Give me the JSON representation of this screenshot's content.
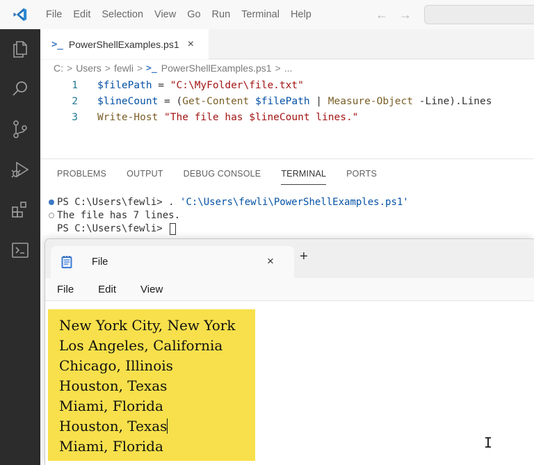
{
  "menubar": {
    "items": [
      "File",
      "Edit",
      "Selection",
      "View",
      "Go",
      "Run",
      "Terminal",
      "Help"
    ],
    "back_arrow": "←",
    "forward_arrow": "→"
  },
  "activity_icons": [
    "explorer-icon",
    "search-icon",
    "source-control-icon",
    "run-debug-icon",
    "extensions-icon",
    "terminal-icon"
  ],
  "editor": {
    "tab": {
      "icon": ">_",
      "label": "PowerShellExamples.ps1",
      "close": "×"
    },
    "breadcrumb": {
      "parts": [
        "C:",
        "Users",
        "fewli",
        "PowerShellExamples.ps1",
        "..."
      ],
      "separator": ">"
    },
    "lines": [
      {
        "num": "1",
        "tokens": [
          {
            "t": "$filePath",
            "k": "var"
          },
          {
            "t": " = ",
            "k": "op"
          },
          {
            "t": "\"C:\\MyFolder\\file.txt\"",
            "k": "str"
          }
        ]
      },
      {
        "num": "2",
        "tokens": [
          {
            "t": "$lineCount",
            "k": "var"
          },
          {
            "t": " = (",
            "k": "op"
          },
          {
            "t": "Get-Content",
            "k": "cmd"
          },
          {
            "t": " ",
            "k": "op"
          },
          {
            "t": "$filePath",
            "k": "var"
          },
          {
            "t": " | ",
            "k": "op"
          },
          {
            "t": "Measure-Object",
            "k": "cmd"
          },
          {
            "t": " -Line).Lines",
            "k": "param"
          }
        ]
      },
      {
        "num": "3",
        "tokens": [
          {
            "t": "Write-Host",
            "k": "cmd"
          },
          {
            "t": " ",
            "k": "op"
          },
          {
            "t": "\"The file has $lineCount lines.\"",
            "k": "str"
          }
        ]
      }
    ]
  },
  "panel": {
    "tabs": [
      "PROBLEMS",
      "OUTPUT",
      "DEBUG CONSOLE",
      "TERMINAL",
      "PORTS"
    ],
    "active_tab": "TERMINAL",
    "terminal": {
      "line1_prompt": "PS C:\\Users\\fewli> . ",
      "line1_path": "'C:\\Users\\fewli\\PowerShellExamples.ps1'",
      "line2": "The file has 7 lines.",
      "line3_prompt": "PS C:\\Users\\fewli> "
    }
  },
  "notepad": {
    "tab_label": "File",
    "tab_close": "×",
    "new_tab": "+",
    "menu": [
      "File",
      "Edit",
      "View"
    ],
    "lines": [
      "New York City, New York",
      "Los Angeles, California",
      "Chicago, Illinois",
      "Houston, Texas",
      "Miami, Florida",
      "Houston, Texas",
      "Miami, Florida"
    ],
    "highlight_color": "#f7e04b"
  },
  "colors": {
    "activity_bar": "#2c2c2c",
    "vscode_blue": "#3b78c3",
    "string": "#a31515",
    "variable": "#0451a5",
    "command": "#795e26"
  }
}
